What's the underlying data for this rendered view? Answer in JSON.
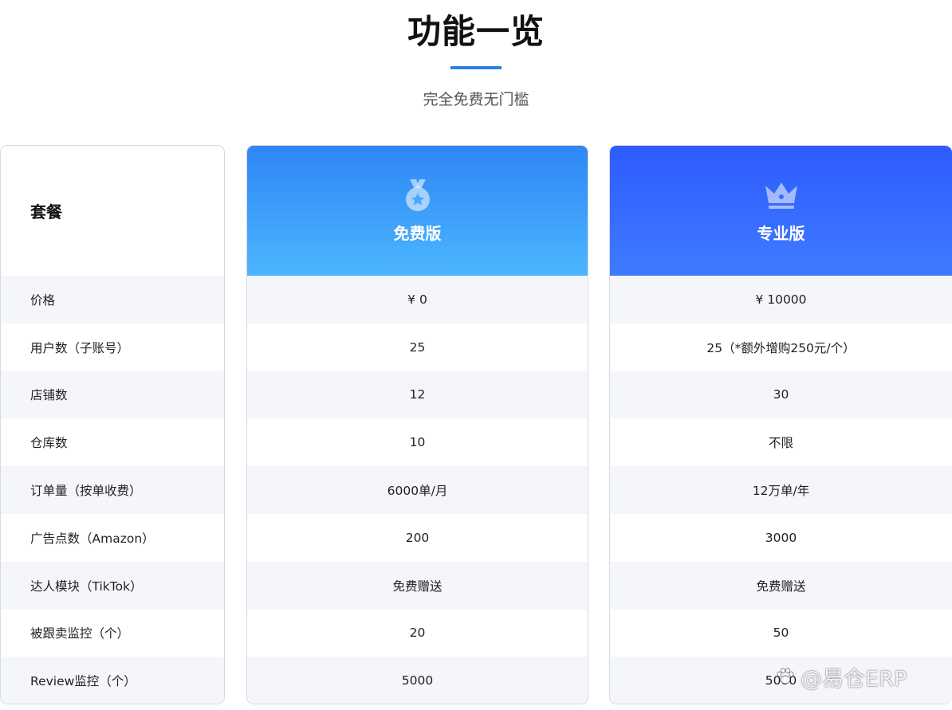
{
  "header": {
    "title": "功能一览",
    "subtitle": "完全免费无门槛",
    "accent_color": "#2f7fde"
  },
  "table": {
    "label_column_header": "套餐",
    "rows": [
      "价格",
      "用户数（子账号）",
      "店铺数",
      "仓库数",
      "订单量（按单收费）",
      "广告点数（Amazon）",
      "达人模块（TikTok）",
      "被跟卖监控（个）",
      "Review监控（个）"
    ],
    "plans": [
      {
        "name": "免费版",
        "icon": "medal-icon",
        "header_colors": [
          "#2e86f5",
          "#4cb6ff"
        ],
        "values": [
          "¥ 0",
          "25",
          "12",
          "10",
          "6000单/月",
          "200",
          "免费赠送",
          "20",
          "5000"
        ]
      },
      {
        "name": "专业版",
        "icon": "crown-icon",
        "header_colors": [
          "#2d5bff",
          "#3f7bff"
        ],
        "values": [
          "¥ 10000",
          "25（*额外增购250元/个）",
          "30",
          "不限",
          "12万单/年",
          "3000",
          "免费赠送",
          "50",
          "5000"
        ]
      }
    ]
  },
  "watermark": {
    "text": "@易仓ERP",
    "icon": "paw-icon"
  }
}
